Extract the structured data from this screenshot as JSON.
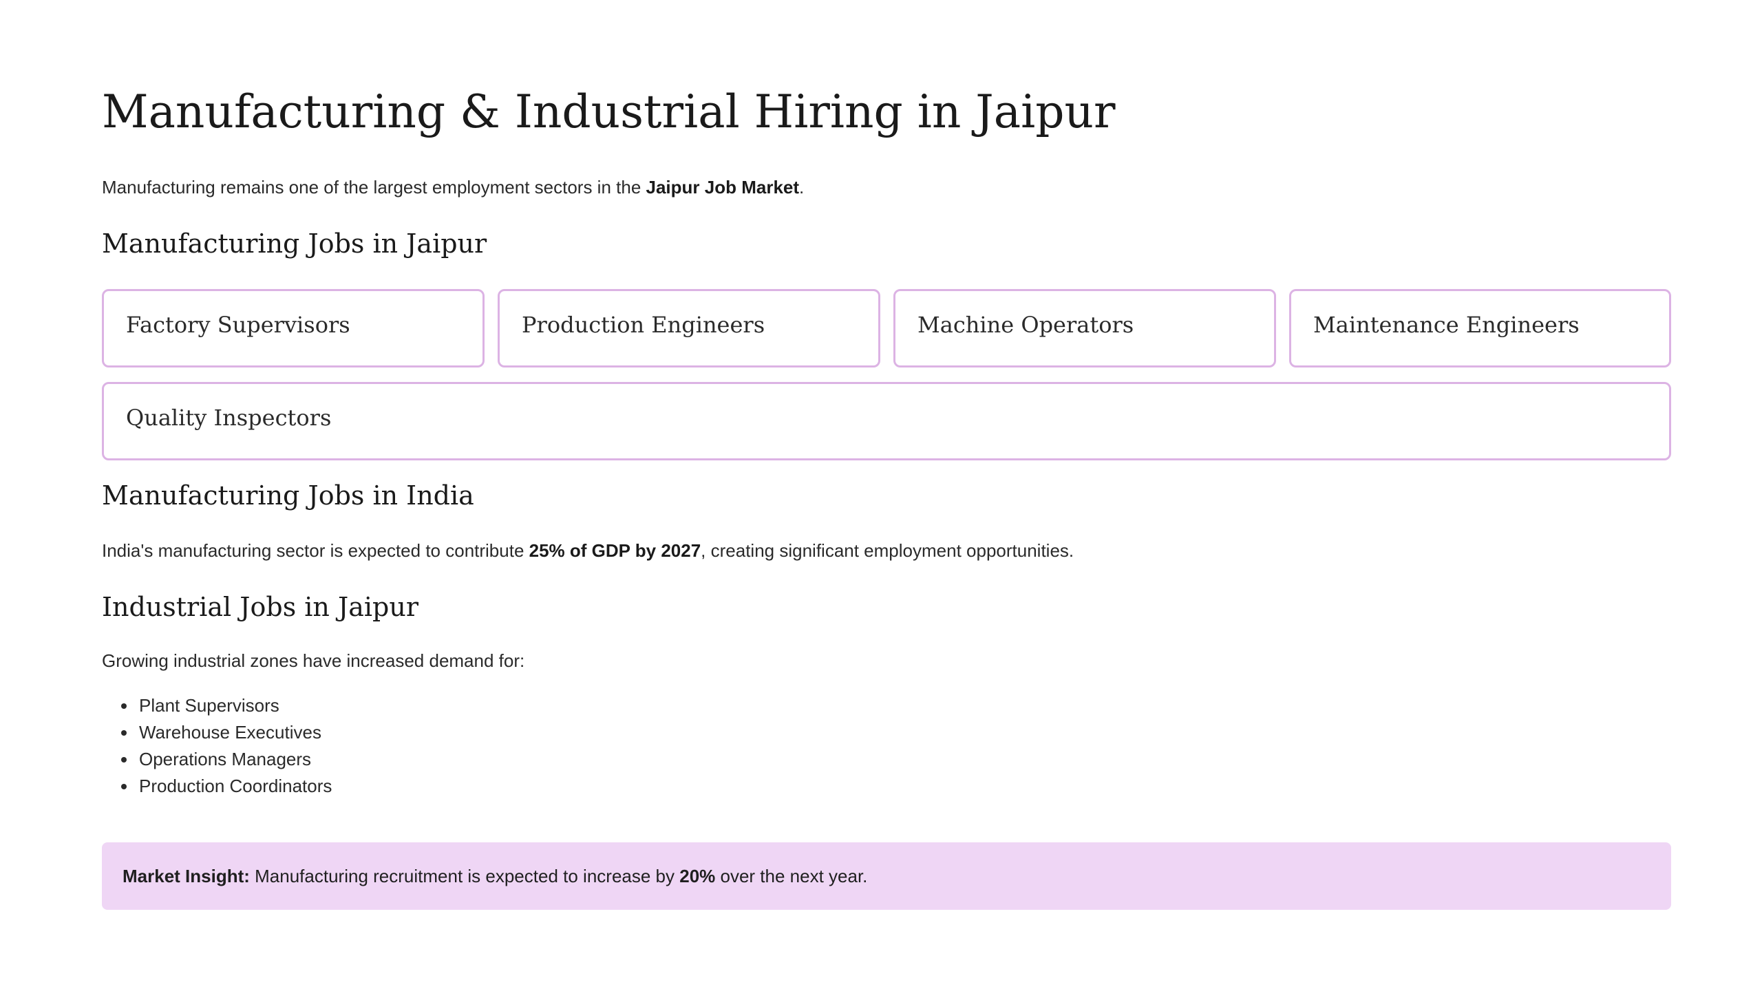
{
  "title": "Manufacturing & Industrial Hiring in Jaipur",
  "intro": {
    "text_before": "Manufacturing remains one of the largest employment sectors in the ",
    "bold": "Jaipur Job Market",
    "text_after": "."
  },
  "section_jaipur": {
    "heading": "Manufacturing Jobs in Jaipur",
    "roles": [
      "Factory Supervisors",
      "Production Engineers",
      "Machine Operators",
      "Maintenance Engineers",
      "Quality Inspectors"
    ]
  },
  "section_india": {
    "heading": "Manufacturing Jobs in India",
    "text_before": "India's manufacturing sector is expected to contribute ",
    "bold": "25% of GDP by 2027",
    "text_after": ", creating significant employment opportunities."
  },
  "section_industrial": {
    "heading": "Industrial Jobs in Jaipur",
    "intro": "Growing industrial zones have increased demand for:",
    "items": [
      "Plant Supervisors",
      "Warehouse Executives",
      "Operations Managers",
      "Production Coordinators"
    ]
  },
  "insight": {
    "label": "Market Insight:",
    "text_before": " Manufacturing recruitment is expected to increase by ",
    "bold": "20%",
    "text_after": " over the next year."
  },
  "colors": {
    "card_border": "#dcb3e4",
    "insight_background": "#efd6f5"
  }
}
